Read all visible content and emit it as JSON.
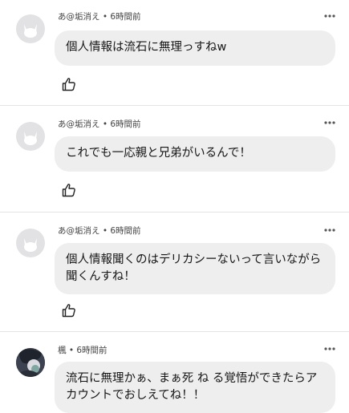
{
  "comments": [
    {
      "author": "あ@垢消え",
      "separator": " • ",
      "time": "6時間前",
      "text": "個人情報は流石に無理っすねw",
      "avatar": "cat-avatar-icon"
    },
    {
      "author": "あ@垢消え",
      "separator": " • ",
      "time": "6時間前",
      "text": "これでも一応親と兄弟がいるんで！",
      "avatar": "cat-avatar-icon"
    },
    {
      "author": "あ@垢消え",
      "separator": " • ",
      "time": "6時間前",
      "text": "個人情報聞くのはデリカシーないって言いながら聞くんすね！",
      "avatar": "cat-avatar-icon"
    },
    {
      "author": "楓",
      "separator": " • ",
      "time": "6時間前",
      "text": "流石に無理かぁ、まぁ死 ね る覚悟ができたらアカウントでおしえてね！！",
      "avatar": "character-avatar-icon"
    }
  ],
  "icons": {
    "more": "more-options-icon",
    "like": "thumbs-up-icon"
  },
  "colors": {
    "bubble": "#eeeeef",
    "divider": "#e4e4e6",
    "avatar_bg": "#e2e2e4"
  }
}
